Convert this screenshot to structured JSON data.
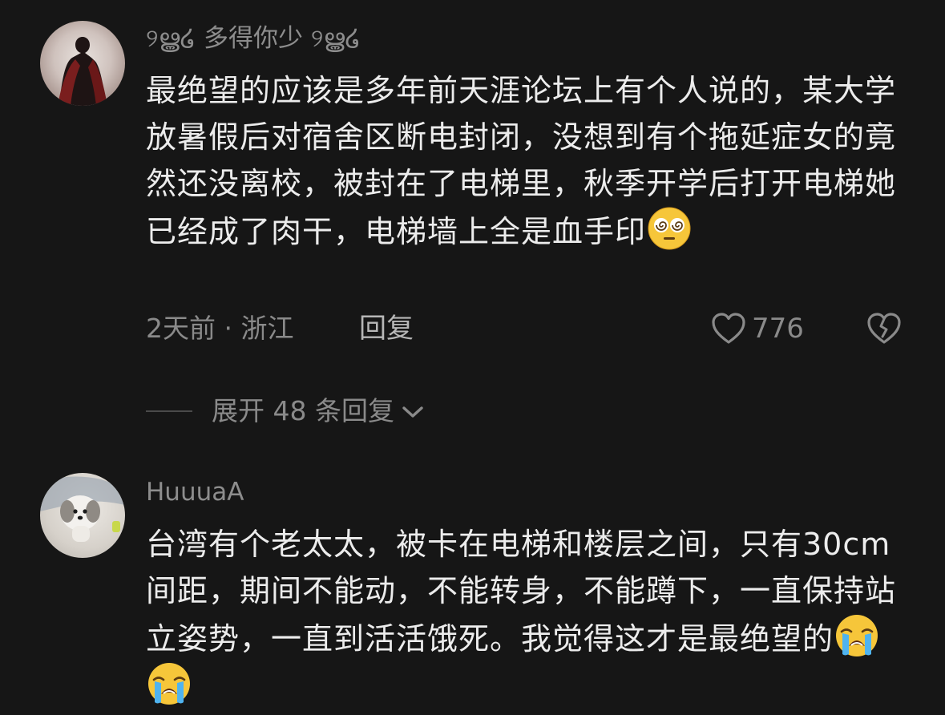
{
  "comments": [
    {
      "username": "୨ൠ໒ 多得你少 ୨ൠ໒",
      "text": "最绝望的应该是多年前天涯论坛上有个人说的，某大学放暑假后对宿舍区断电封闭，没想到有个拖延症女的竟然还没离校，被封在了电梯里，秋季开学后打开电梯她已经成了肉干，电梯墙上全是血手印",
      "emoji": "dizzy-face-emoji",
      "time_location": "2天前 · 浙江",
      "reply_label": "回复",
      "likes": "776",
      "expand_replies": "展开 48 条回复"
    },
    {
      "username": "HuuuaA",
      "text": "台湾有个老太太，被卡在电梯和楼层之间，只有30cm间距，期间不能动，不能转身，不能蹲下，一直保持站立姿势，一直到活活饿死。我觉得这才是最绝望的",
      "emoji": "loudly-crying-face-emoji"
    }
  ]
}
